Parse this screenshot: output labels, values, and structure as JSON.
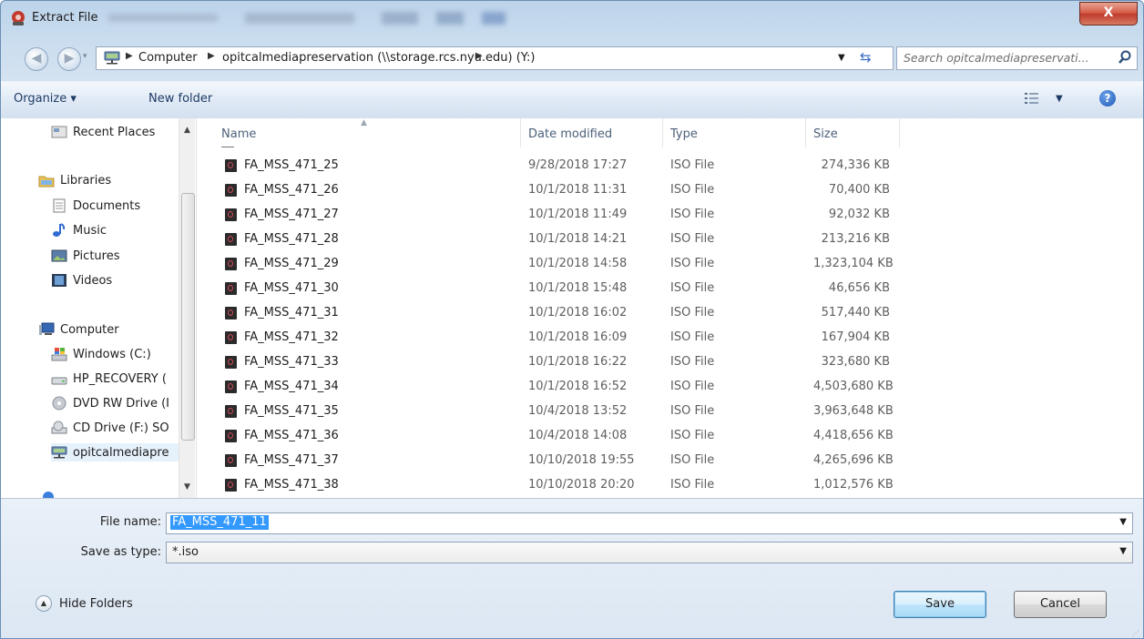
{
  "window": {
    "title": "Extract File",
    "close_label": "X"
  },
  "address": {
    "crumbs": [
      "Computer",
      "opitcalmediapreservation (\\\\storage.rcs.nyu.edu) (Y:)"
    ],
    "search_placeholder": "Search opitcalmediapreservati..."
  },
  "toolbar": {
    "organize": "Organize ▾",
    "new_folder": "New folder"
  },
  "nav": {
    "items": [
      {
        "label": "Recent Places"
      },
      {
        "label": "Libraries"
      },
      {
        "label": "Documents"
      },
      {
        "label": "Music"
      },
      {
        "label": "Pictures"
      },
      {
        "label": "Videos"
      },
      {
        "label": "Computer"
      },
      {
        "label": "Windows  (C:)"
      },
      {
        "label": "HP_RECOVERY ("
      },
      {
        "label": "DVD RW Drive (I"
      },
      {
        "label": "CD Drive (F:) SO"
      },
      {
        "label": "opitcalmediapre"
      }
    ]
  },
  "columns": {
    "name": "Name",
    "date": "Date modified",
    "type": "Type",
    "size": "Size"
  },
  "files": [
    {
      "name": "FA_MSS_471_25",
      "date": "9/28/2018 17:27",
      "type": "ISO File",
      "size": "274,336 KB"
    },
    {
      "name": "FA_MSS_471_26",
      "date": "10/1/2018 11:31",
      "type": "ISO File",
      "size": "70,400 KB"
    },
    {
      "name": "FA_MSS_471_27",
      "date": "10/1/2018 11:49",
      "type": "ISO File",
      "size": "92,032 KB"
    },
    {
      "name": "FA_MSS_471_28",
      "date": "10/1/2018 14:21",
      "type": "ISO File",
      "size": "213,216 KB"
    },
    {
      "name": "FA_MSS_471_29",
      "date": "10/1/2018 14:58",
      "type": "ISO File",
      "size": "1,323,104 KB"
    },
    {
      "name": "FA_MSS_471_30",
      "date": "10/1/2018 15:48",
      "type": "ISO File",
      "size": "46,656 KB"
    },
    {
      "name": "FA_MSS_471_31",
      "date": "10/1/2018 16:02",
      "type": "ISO File",
      "size": "517,440 KB"
    },
    {
      "name": "FA_MSS_471_32",
      "date": "10/1/2018 16:09",
      "type": "ISO File",
      "size": "167,904 KB"
    },
    {
      "name": "FA_MSS_471_33",
      "date": "10/1/2018 16:22",
      "type": "ISO File",
      "size": "323,680 KB"
    },
    {
      "name": "FA_MSS_471_34",
      "date": "10/1/2018 16:52",
      "type": "ISO File",
      "size": "4,503,680 KB"
    },
    {
      "name": "FA_MSS_471_35",
      "date": "10/4/2018 13:52",
      "type": "ISO File",
      "size": "3,963,648 KB"
    },
    {
      "name": "FA_MSS_471_36",
      "date": "10/4/2018 14:08",
      "type": "ISO File",
      "size": "4,418,656 KB"
    },
    {
      "name": "FA_MSS_471_37",
      "date": "10/10/2018 19:55",
      "type": "ISO File",
      "size": "4,265,696 KB"
    },
    {
      "name": "FA_MSS_471_38",
      "date": "10/10/2018 20:20",
      "type": "ISO File",
      "size": "1,012,576 KB"
    }
  ],
  "form": {
    "file_name_label": "File name:",
    "file_name_value": "FA_MSS_471_11",
    "save_type_label": "Save as type:",
    "save_type_value": "*.iso",
    "hide_folders": "Hide Folders",
    "save": "Save",
    "cancel": "Cancel"
  },
  "colors": {
    "selection": "#3399ff",
    "chrome": "#c9dcee",
    "close": "#c0392b"
  }
}
